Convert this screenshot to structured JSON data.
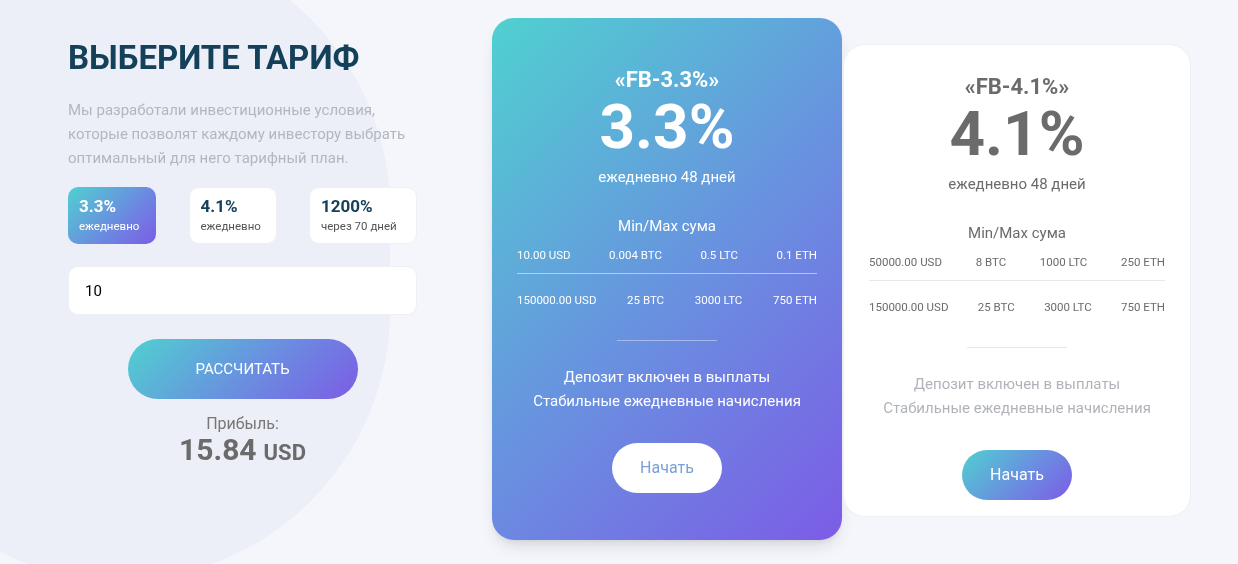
{
  "heading": "ВЫБЕРИТЕ ТАРИФ",
  "description": "Мы разработали инвестиционные условия, которые позволят каждому инвестору выбрать оптимальный для него тарифный план.",
  "options": [
    {
      "value": "3.3%",
      "label": "ежедневно",
      "selected": true
    },
    {
      "value": "4.1%",
      "label": "ежедневно",
      "selected": false
    },
    {
      "value": "1200%",
      "label": "через 70 дней",
      "selected": false
    }
  ],
  "amount_field": {
    "value": "10"
  },
  "calculate_button": "РАССЧИТАТЬ",
  "profit": {
    "label": "Прибыль:",
    "amount": "15.84",
    "currency": "USD"
  },
  "plans": [
    {
      "name": "«FB-3.3%»",
      "rate": "3.3%",
      "term": "ежедневно 48 дней",
      "range_label": "Min/Max сума",
      "highlighted": true,
      "min": [
        "10.00 USD",
        "0.004 BTC",
        "0.5 LTC",
        "0.1 ETH"
      ],
      "max": [
        "150000.00 USD",
        "25 BTC",
        "3000 LTC",
        "750 ETH"
      ],
      "features": [
        "Депозит включен в выплаты",
        "Стабильные ежедневные начисления"
      ],
      "button": "Начать"
    },
    {
      "name": "«FB-4.1%»",
      "rate": "4.1%",
      "term": "ежедневно 48 дней",
      "range_label": "Min/Max сума",
      "highlighted": false,
      "min": [
        "50000.00 USD",
        "8 BTC",
        "1000 LTC",
        "250 ETH"
      ],
      "max": [
        "150000.00 USD",
        "25 BTC",
        "3000 LTC",
        "750 ETH"
      ],
      "features": [
        "Депозит включен в выплаты",
        "Стабильные ежедневные начисления"
      ],
      "button": "Начать"
    }
  ]
}
